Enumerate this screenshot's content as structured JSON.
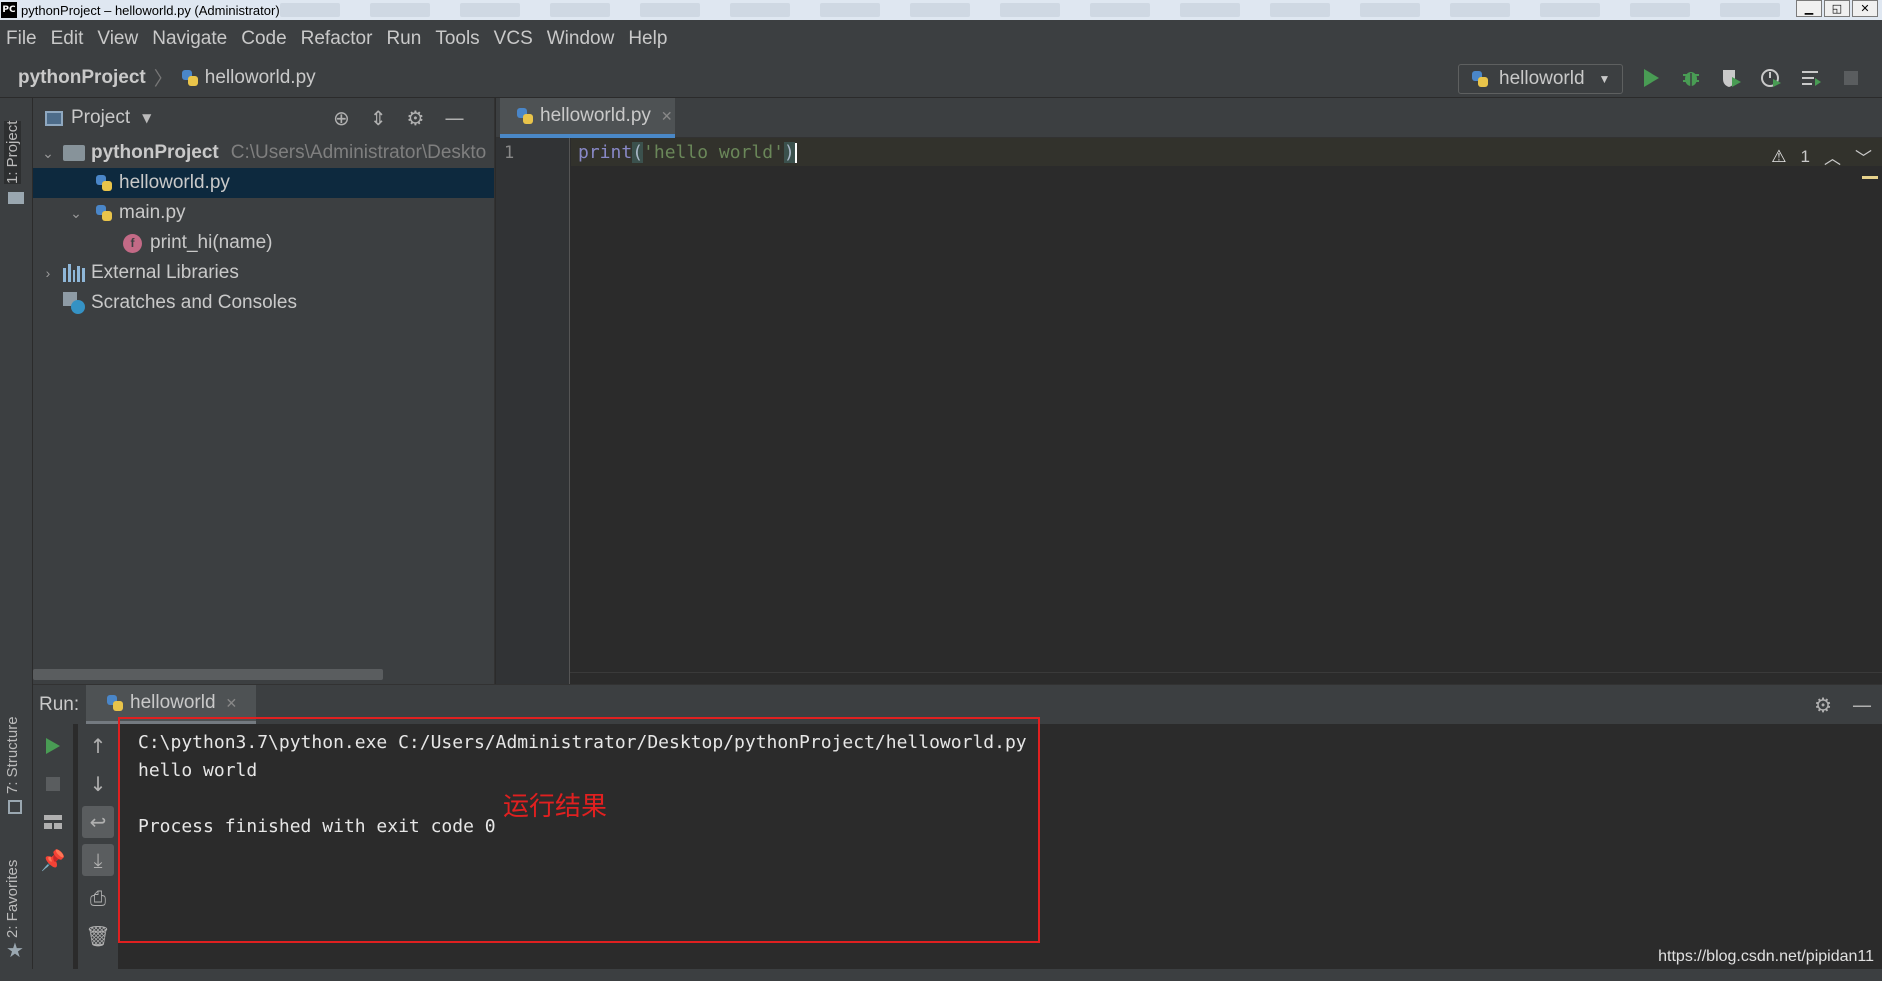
{
  "window": {
    "title": "pythonProject – helloworld.py (Administrator)",
    "app_badge": "PC",
    "controls": [
      "▁",
      "◱",
      "✕"
    ]
  },
  "menu": [
    "File",
    "Edit",
    "View",
    "Navigate",
    "Code",
    "Refactor",
    "Run",
    "Tools",
    "VCS",
    "Window",
    "Help"
  ],
  "breadcrumb": {
    "project": "pythonProject",
    "separator": "〉",
    "file": "helloworld.py"
  },
  "run_config": {
    "label": "helloworld"
  },
  "left_strip": {
    "project_tab": "1: Project",
    "structure_tab": "7: Structure",
    "favorites_tab": "2: Favorites"
  },
  "project_panel": {
    "title": "Project",
    "tree": {
      "root": {
        "name": "pythonProject",
        "path": "C:\\Users\\Administrator\\Deskto"
      },
      "file1": "helloworld.py",
      "file2": "main.py",
      "func": "print_hi(name)",
      "func_badge": "f",
      "libs": "External Libraries",
      "scratches": "Scratches and Consoles"
    }
  },
  "editor": {
    "tab": "helloworld.py",
    "line_number": "1",
    "code": {
      "func": "print",
      "open": "(",
      "str": "'hello world'",
      "close": ")"
    },
    "inspection": {
      "count": "1"
    }
  },
  "run_panel": {
    "label": "Run:",
    "tab": "helloworld",
    "output": {
      "line1": "C:\\python3.7\\python.exe C:/Users/Administrator/Desktop/pythonProject/helloworld.py",
      "line2": "hello world",
      "line3": "Process finished with exit code 0"
    },
    "annotation": "运行结果"
  },
  "watermark": "https://blog.csdn.net/pipidan11",
  "colors": {
    "accent": "#4a88c7",
    "highlight_red": "#e02020",
    "run_green": "#499c54"
  }
}
